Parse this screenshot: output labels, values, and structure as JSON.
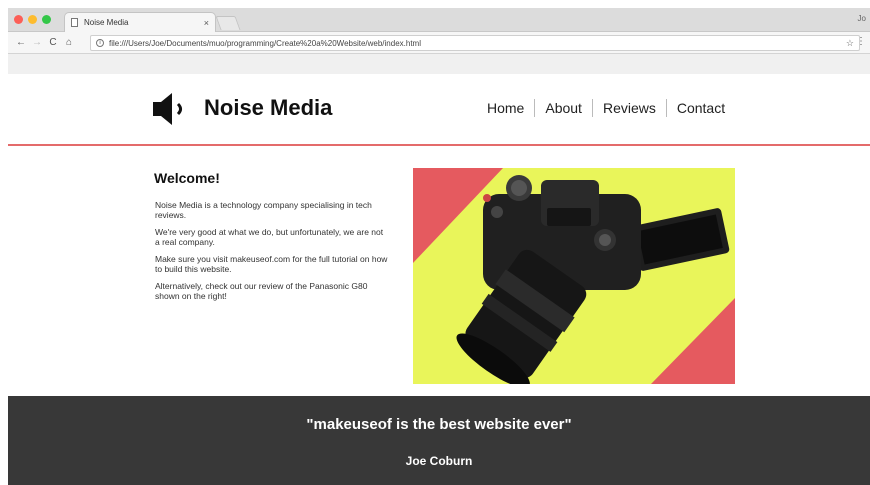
{
  "browser": {
    "tab_title": "Noise Media",
    "tab_close": "×",
    "profile": "Jo",
    "url": "file:///Users/Joe/Documents/muo/programming/Create%20a%20Website/web/index.html",
    "nav": {
      "back": "←",
      "forward": "→",
      "reload": "C",
      "home": "⌂"
    },
    "star": "☆",
    "menu": "⋮",
    "info": "i"
  },
  "site": {
    "name": "Noise Media",
    "nav": [
      "Home",
      "About",
      "Reviews",
      "Contact"
    ],
    "accent_color": "#e46b6b"
  },
  "main": {
    "title": "Welcome!",
    "paragraphs": [
      "Noise Media is a technology company specialising in tech reviews.",
      "We're very good at what we do, but unfortunately, we are not a real company.",
      "Make sure you visit makeuseof.com for the full tutorial on how to build this website.",
      "Alternatively, check out our review of the Panasonic G80 shown on the right!"
    ],
    "image_icon": "camera-photo"
  },
  "footer": {
    "quote": "\"makeuseof is the best website ever\"",
    "author": "Joe Coburn",
    "background": "#383838"
  }
}
